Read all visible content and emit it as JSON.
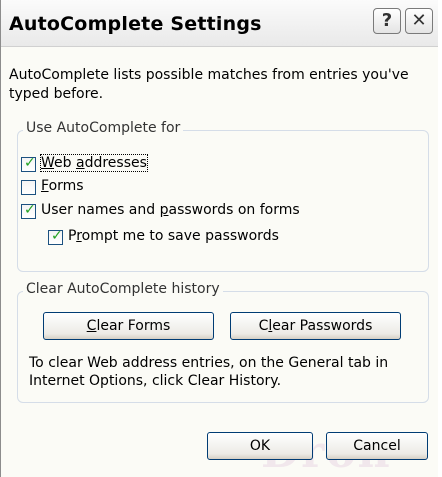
{
  "window": {
    "title": "AutoComplete Settings"
  },
  "titlebar": {
    "help_glyph": "?",
    "close_glyph": "✕"
  },
  "intro": {
    "line1": "AutoComplete lists possible matches from entries you've",
    "line2": "typed before."
  },
  "use_group": {
    "legend": "Use AutoComplete for",
    "web_addresses": {
      "pre": "",
      "key": "W",
      "post": "eb ",
      "key2": "a",
      "post2": "ddresses",
      "checked": true
    },
    "forms": {
      "key": "F",
      "post": "orms",
      "checked": false
    },
    "user_names": {
      "pre": "User names and ",
      "key": "p",
      "post": "asswords on forms",
      "checked": true
    },
    "prompt": {
      "pre": "P",
      "key": "r",
      "post": "ompt me to save passwords",
      "checked": true
    }
  },
  "clear_group": {
    "legend": "Clear AutoComplete history",
    "clear_forms": {
      "key": "C",
      "post": "lear Forms"
    },
    "clear_passwords": {
      "pre": "C",
      "key": "l",
      "post": "ear Passwords"
    },
    "note_line1": "To clear Web address entries, on the General tab in",
    "note_line2": "Internet Options, click Clear History."
  },
  "footer": {
    "ok": "OK",
    "cancel": "Cancel"
  },
  "check_glyph": "✓",
  "watermark": "Dron"
}
